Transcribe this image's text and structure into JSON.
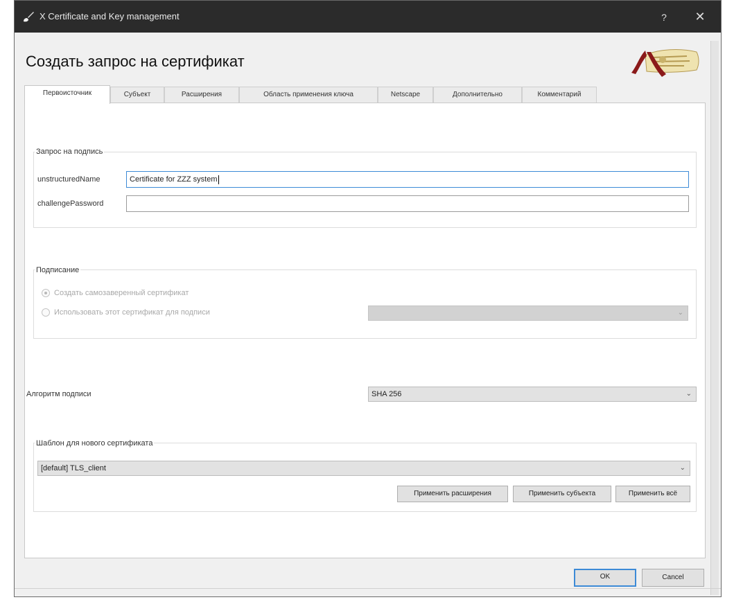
{
  "window": {
    "title": "X Certificate and Key management",
    "help_glyph": "?",
    "close_glyph": "✕"
  },
  "heading": "Создать запрос на сертификат",
  "tabs": [
    {
      "label": "Первоисточник",
      "active": true
    },
    {
      "label": "Субъект",
      "active": false
    },
    {
      "label": "Расширения",
      "active": false
    },
    {
      "label": "Область применения ключа",
      "active": false
    },
    {
      "label": "Netscape",
      "active": false
    },
    {
      "label": "Дополнительно",
      "active": false
    },
    {
      "label": "Комментарий",
      "active": false
    }
  ],
  "signing_request": {
    "group_title": "Запрос на подпись",
    "unstructured_name_label": "unstructuredName",
    "unstructured_name_value": "Certificate for ZZZ system",
    "challenge_password_label": "challengePassword",
    "challenge_password_value": ""
  },
  "signing": {
    "group_title": "Подписание",
    "option_self_signed": "Создать самозаверенный сертификат",
    "option_use_cert": "Использовать этот сертификат для подписи",
    "selected_option": "self_signed",
    "cert_select_value": ""
  },
  "algorithm": {
    "label": "Алгоритм подписи",
    "value": "SHA 256"
  },
  "template": {
    "group_title": "Шаблон для нового сертификата",
    "value": "[default] TLS_client",
    "apply_extensions": "Применить расширения",
    "apply_subject": "Применить субъекта",
    "apply_all": "Применить всё"
  },
  "footer": {
    "ok": "OK",
    "cancel": "Cancel"
  },
  "icons": {
    "app": "brush-icon",
    "logo": "certificate-scroll-logo",
    "dropdown": "chevron-down-icon"
  },
  "colors": {
    "titlebar": "#2b2b2b",
    "focus_border": "#3c8ad6",
    "logo_ribbon": "#8b1a1a"
  }
}
